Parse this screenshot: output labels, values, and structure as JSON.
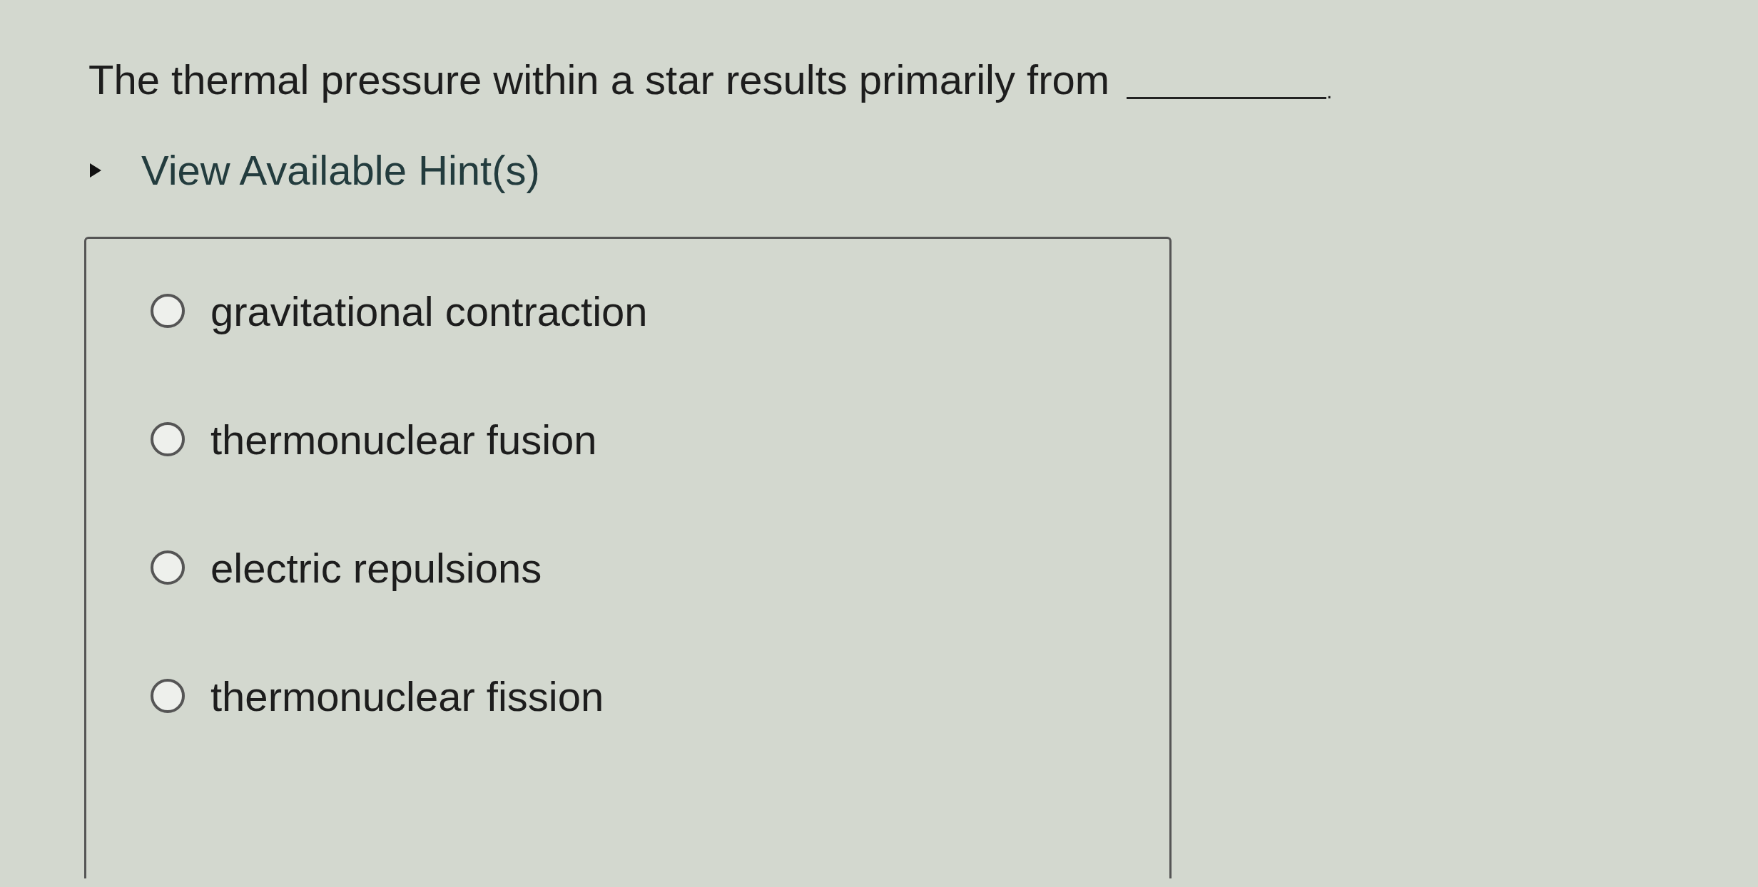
{
  "question": {
    "text": "The thermal pressure within a star results primarily from",
    "end": "."
  },
  "hints": {
    "label": "View Available Hint(s)",
    "expanded": false
  },
  "options": [
    {
      "label": "gravitational contraction",
      "selected": false
    },
    {
      "label": "thermonuclear fusion",
      "selected": false
    },
    {
      "label": "electric repulsions",
      "selected": false
    },
    {
      "label": "thermonuclear fission",
      "selected": false
    }
  ]
}
